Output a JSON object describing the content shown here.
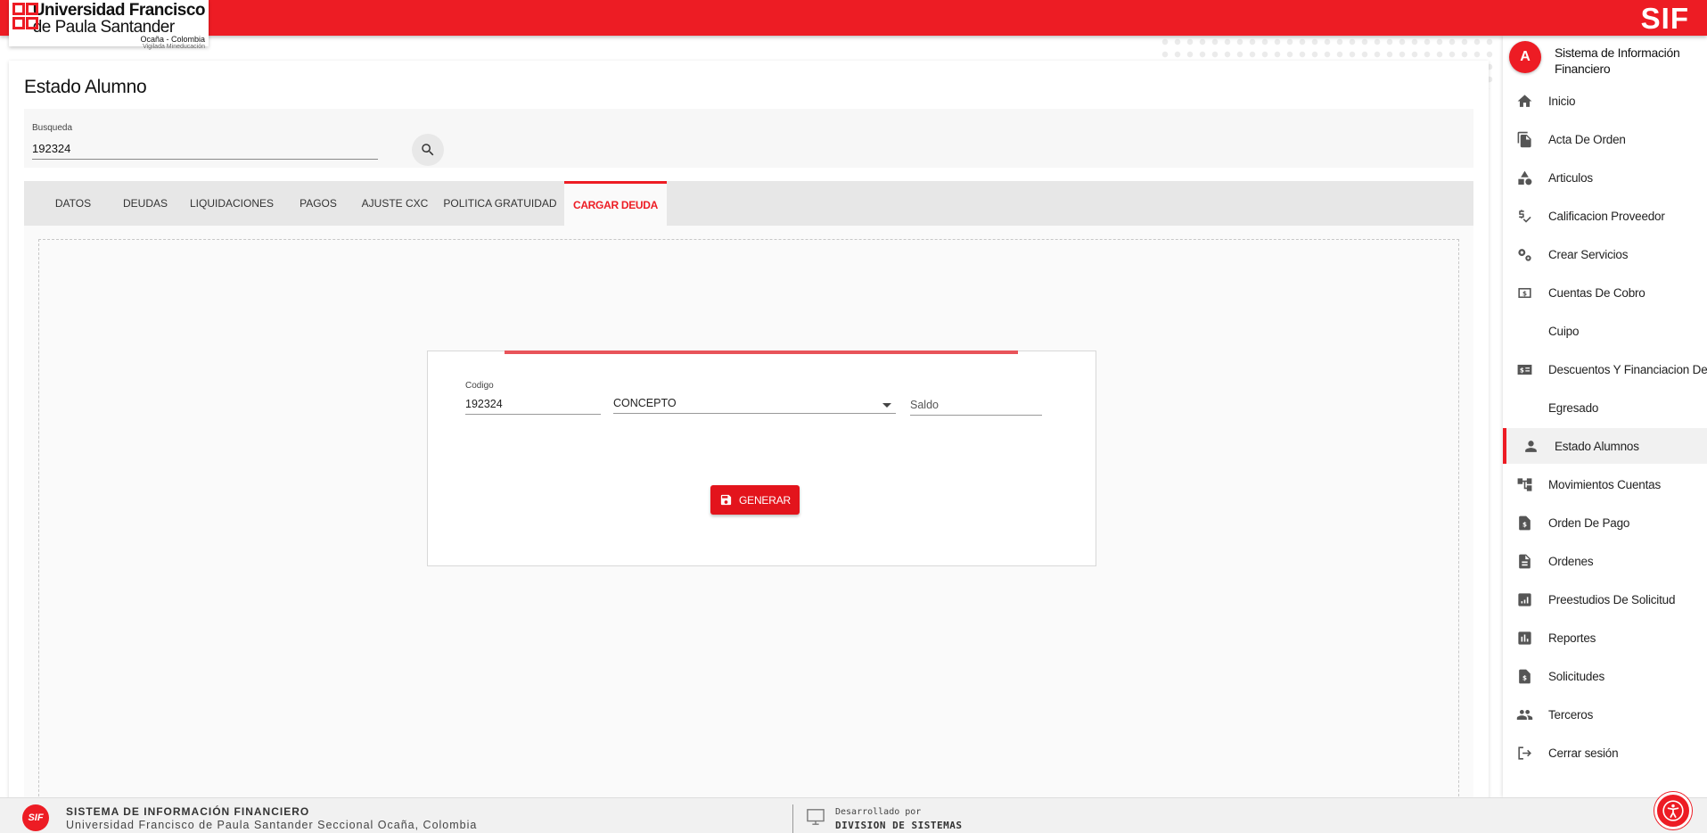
{
  "header": {
    "logo": {
      "line1": "Universidad Francisco",
      "line2": "de Paula Santander",
      "line3": "Ocaña - Colombia",
      "line4": "Vigilada Mineducación"
    },
    "brand": "SIF",
    "accent_color": "#ed1c24"
  },
  "page": {
    "title": "Estado Alumno",
    "search": {
      "label": "Busqueda",
      "value": "192324",
      "icon": "search-icon"
    }
  },
  "tabs": [
    {
      "label": "DATOS",
      "active": false
    },
    {
      "label": "DEUDAS",
      "active": false
    },
    {
      "label": "LIQUIDACIONES",
      "active": false
    },
    {
      "label": "PAGOS",
      "active": false
    },
    {
      "label": "AJUSTE CXC",
      "active": false
    },
    {
      "label": "POLITICA GRATUIDAD",
      "active": false
    },
    {
      "label": "CARGAR DEUDA",
      "active": true
    }
  ],
  "form": {
    "codigo": {
      "label": "Codigo",
      "value": "192324"
    },
    "concepto": {
      "value": "CONCEPTO"
    },
    "saldo": {
      "placeholder": "Saldo"
    },
    "generate_label": "GENERAR"
  },
  "sidebar": {
    "avatar": "A",
    "title": "Sistema de Información Financiero",
    "items": [
      {
        "label": "Inicio",
        "icon": "home-icon"
      },
      {
        "label": "Acta De Orden",
        "icon": "file-copy-icon"
      },
      {
        "label": "Articulos",
        "icon": "category-icon"
      },
      {
        "label": "Calificacion Proveedor",
        "icon": "price-check-icon"
      },
      {
        "label": "Crear Servicios",
        "icon": "gears-icon"
      },
      {
        "label": "Cuentas De Cobro",
        "icon": "money-icon"
      },
      {
        "label": "Cuipo",
        "icon": ""
      },
      {
        "label": "Descuentos Y Financiacion De",
        "icon": "money-list-icon"
      },
      {
        "label": "Egresado",
        "icon": ""
      },
      {
        "label": "Estado Alumnos",
        "icon": "person-icon",
        "active": true
      },
      {
        "label": "Movimientos Cuentas",
        "icon": "account-tree-icon"
      },
      {
        "label": "Orden De Pago",
        "icon": "request-quote-icon"
      },
      {
        "label": "Ordenes",
        "icon": "description-icon"
      },
      {
        "label": "Preestudios De Solicitud",
        "icon": "chart-box-icon"
      },
      {
        "label": "Reportes",
        "icon": "bar-chart-icon"
      },
      {
        "label": "Solicitudes",
        "icon": "request-quote-icon"
      },
      {
        "label": "Terceros",
        "icon": "people-icon"
      },
      {
        "label": "Cerrar sesión",
        "icon": "logout-icon"
      }
    ]
  },
  "footer": {
    "logo": "SIF",
    "title": "SISTEMA DE INFORMACIÓN FINANCIERO",
    "subtitle": "Universidad Francisco de Paula Santander Seccional Ocaña, Colombia",
    "dev_label": "Desarrollado por",
    "dev_name": "DIVISION DE SISTEMAS"
  }
}
